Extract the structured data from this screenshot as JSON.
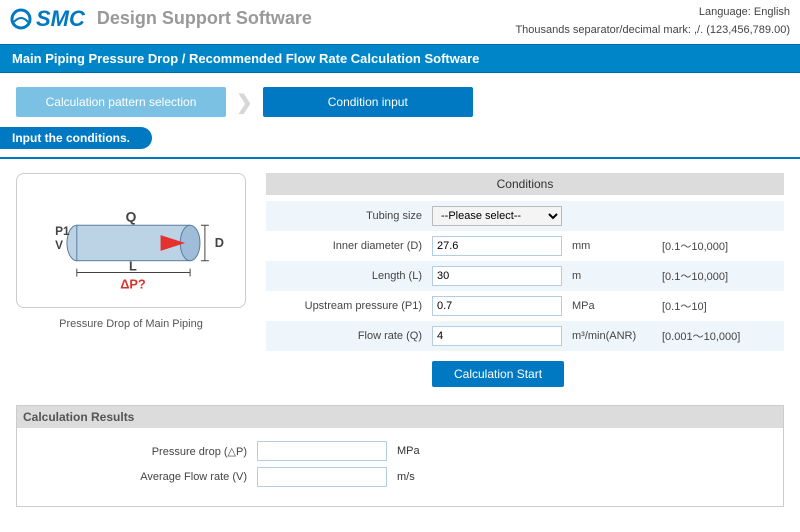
{
  "header": {
    "brand": "SMC",
    "app_title": "Design Support Software",
    "language_label": "Language:",
    "language_value": "English",
    "format_note": "Thousands separator/decimal mark: ,/. (123,456,789.00)"
  },
  "title_bar": "Main Piping Pressure Drop / Recommended Flow Rate Calculation Software",
  "steps": {
    "s1": "Calculation pattern selection",
    "s2": "Condition input"
  },
  "instruction": "Input the conditions.",
  "diagram": {
    "caption": "Pressure Drop of Main Piping",
    "Q": "Q",
    "D": "D",
    "L": "L",
    "P1": "P1",
    "V": "V",
    "dP": "ΔP?"
  },
  "conditions": {
    "heading": "Conditions",
    "tubing_size": {
      "label": "Tubing size",
      "value": "--Please select--"
    },
    "inner_diameter": {
      "label": "Inner diameter (D)",
      "value": "27.6",
      "unit": "mm",
      "range": "[0.1～10,000]"
    },
    "length": {
      "label": "Length (L)",
      "value": "30",
      "unit": "m",
      "range": "[0.1～10,000]"
    },
    "upstream_pressure": {
      "label": "Upstream pressure (P1)",
      "value": "0.7",
      "unit": "MPa",
      "range": "[0.1～10]"
    },
    "flow_rate": {
      "label": "Flow rate (Q)",
      "value": "4",
      "unit": "m³/min(ANR)",
      "range": "[0.001～10,000]"
    },
    "calc_button": "Calculation Start"
  },
  "results": {
    "heading": "Calculation Results",
    "pressure_drop": {
      "label": "Pressure drop (△P)",
      "value": "",
      "unit": "MPa"
    },
    "avg_flow": {
      "label": "Average Flow rate (V)",
      "value": "",
      "unit": "m/s"
    }
  }
}
